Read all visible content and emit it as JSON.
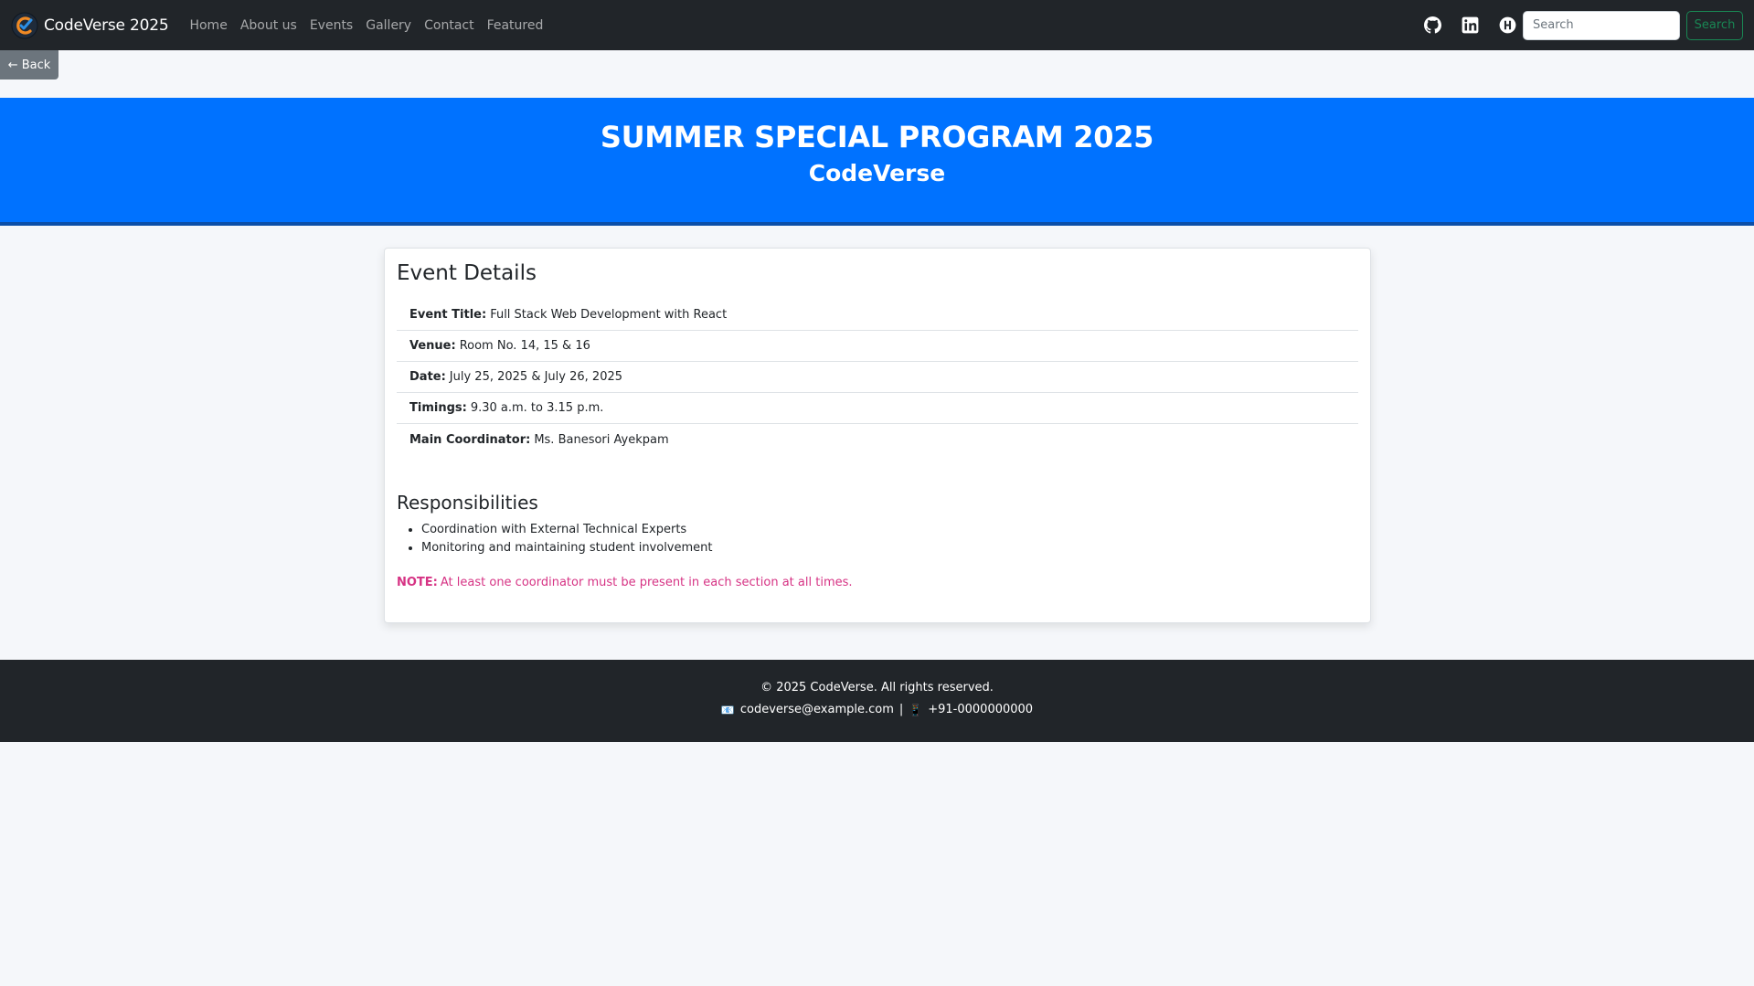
{
  "navbar": {
    "brand": "CodeVerse 2025",
    "links": [
      "Home",
      "About us",
      "Events",
      "Gallery",
      "Contact",
      "Featured"
    ],
    "icons": [
      "github-icon",
      "linkedin-icon",
      "theme-toggle-icon"
    ],
    "search_placeholder": "Search",
    "search_button": "Search"
  },
  "back_button": "← Back",
  "hero": {
    "title": "SUMMER SPECIAL PROGRAM 2025",
    "subtitle": "CodeVerse"
  },
  "event": {
    "heading": "Event Details",
    "details": [
      {
        "label": "Event Title:",
        "value": "Full Stack Web Development with React"
      },
      {
        "label": "Venue:",
        "value": "Room No. 14, 15 & 16"
      },
      {
        "label": "Date:",
        "value": "July 25, 2025 & July 26, 2025"
      },
      {
        "label": "Timings:",
        "value": "9.30 a.m. to 3.15 p.m."
      },
      {
        "label": "Main Coordinator:",
        "value": "Ms. Banesori Ayekpam"
      }
    ],
    "responsibilities_heading": "Responsibilities",
    "responsibilities": [
      "Coordination with External Technical Experts",
      "Monitoring and maintaining student involvement"
    ],
    "note_label": "NOTE:",
    "note_text": "At least one coordinator must be present in each section at all times."
  },
  "footer": {
    "copyright": "© 2025 CodeVerse. All rights reserved.",
    "email_icon": "📧",
    "email": "codeverse@example.com",
    "separator": "|",
    "phone_icon": "📱",
    "phone": "+91-0000000000"
  },
  "colors": {
    "navbar_bg": "#212529",
    "hero_bg": "#0072ff",
    "note": "#d63384",
    "search_button": "#198754",
    "back_button": "#6c757d"
  }
}
